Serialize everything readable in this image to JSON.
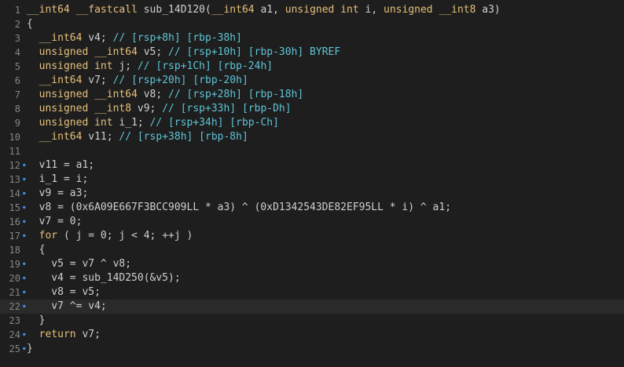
{
  "lines": [
    {
      "num": "1",
      "marker": false,
      "text": "__int64 __fastcall sub_14D120(__int64 a1, unsigned int i, unsigned __int8 a3)"
    },
    {
      "num": "2",
      "marker": false,
      "text": "{"
    },
    {
      "num": "3",
      "marker": false,
      "text": "  __int64 v4; // [rsp+8h] [rbp-38h]"
    },
    {
      "num": "4",
      "marker": false,
      "text": "  unsigned __int64 v5; // [rsp+10h] [rbp-30h] BYREF"
    },
    {
      "num": "5",
      "marker": false,
      "text": "  unsigned int j; // [rsp+1Ch] [rbp-24h]"
    },
    {
      "num": "6",
      "marker": false,
      "text": "  __int64 v7; // [rsp+20h] [rbp-20h]"
    },
    {
      "num": "7",
      "marker": false,
      "text": "  unsigned __int64 v8; // [rsp+28h] [rbp-18h]"
    },
    {
      "num": "8",
      "marker": false,
      "text": "  unsigned __int8 v9; // [rsp+33h] [rbp-Dh]"
    },
    {
      "num": "9",
      "marker": false,
      "text": "  unsigned int i_1; // [rsp+34h] [rbp-Ch]"
    },
    {
      "num": "10",
      "marker": false,
      "text": "  __int64 v11; // [rsp+38h] [rbp-8h]"
    },
    {
      "num": "11",
      "marker": false,
      "text": ""
    },
    {
      "num": "12",
      "marker": true,
      "text": "  v11 = a1;"
    },
    {
      "num": "13",
      "marker": true,
      "text": "  i_1 = i;"
    },
    {
      "num": "14",
      "marker": true,
      "text": "  v9 = a3;"
    },
    {
      "num": "15",
      "marker": true,
      "text": "  v8 = (0x6A09E667F3BCC909LL * a3) ^ (0xD1342543DE82EF95LL * i) ^ a1;"
    },
    {
      "num": "16",
      "marker": true,
      "text": "  v7 = 0;"
    },
    {
      "num": "17",
      "marker": true,
      "text": "  for ( j = 0; j < 4; ++j )"
    },
    {
      "num": "18",
      "marker": false,
      "text": "  {"
    },
    {
      "num": "19",
      "marker": true,
      "text": "    v5 = v7 ^ v8;"
    },
    {
      "num": "20",
      "marker": true,
      "text": "    v4 = sub_14D250(&v5);"
    },
    {
      "num": "21",
      "marker": true,
      "text": "    v8 = v5;"
    },
    {
      "num": "22",
      "marker": true,
      "text": "    v7 ^= v4;"
    },
    {
      "num": "23",
      "marker": false,
      "text": "  }"
    },
    {
      "num": "24",
      "marker": true,
      "text": "  return v7;"
    },
    {
      "num": "25",
      "marker": true,
      "text": "}"
    }
  ],
  "current_line": "22",
  "colors": {
    "background": "#1e1e1e",
    "keyword": "#e6c07b",
    "comment": "#5ec4d6",
    "line_number": "#858585",
    "marker": "#3b8eea"
  },
  "icons": {
    "marker": "breakpoint-dot-icon"
  }
}
